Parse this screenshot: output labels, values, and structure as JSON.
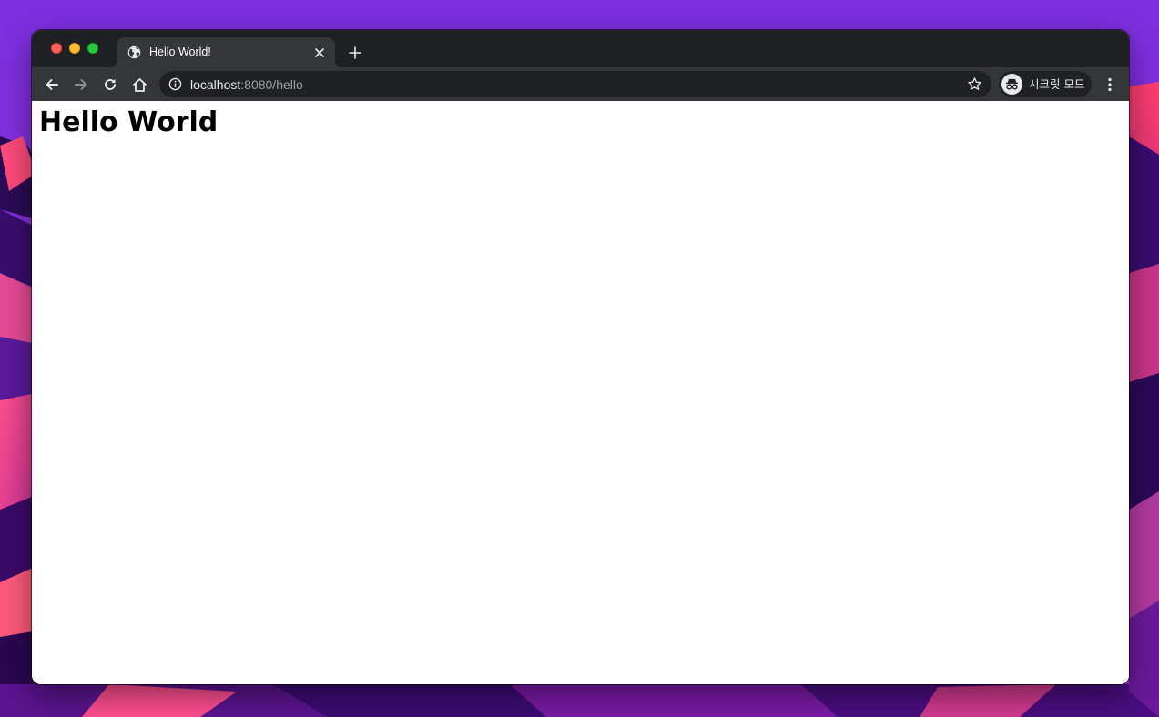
{
  "colors": {
    "tabstrip": "#1f2023",
    "toolbar": "#35363a",
    "omnibox": "#202124",
    "url_host": "#e8eaed",
    "url_rest": "#9aa0a6"
  },
  "tab": {
    "title": "Hello World!",
    "favicon": "globe-icon",
    "close_icon": "close-icon"
  },
  "new_tab_icon": "plus-icon",
  "toolbar": {
    "back_icon": "arrow-left-icon",
    "forward_icon": "arrow-right-icon",
    "reload_icon": "reload-icon",
    "home_icon": "home-icon",
    "menu_icon": "kebab-menu-icon"
  },
  "address_bar": {
    "site_info_icon": "info-icon",
    "host": "localhost",
    "rest": ":8080/hello",
    "bookmark_icon": "star-icon"
  },
  "profile": {
    "icon": "incognito-icon",
    "label": "시크릿 모드"
  },
  "page": {
    "heading": "Hello World"
  }
}
